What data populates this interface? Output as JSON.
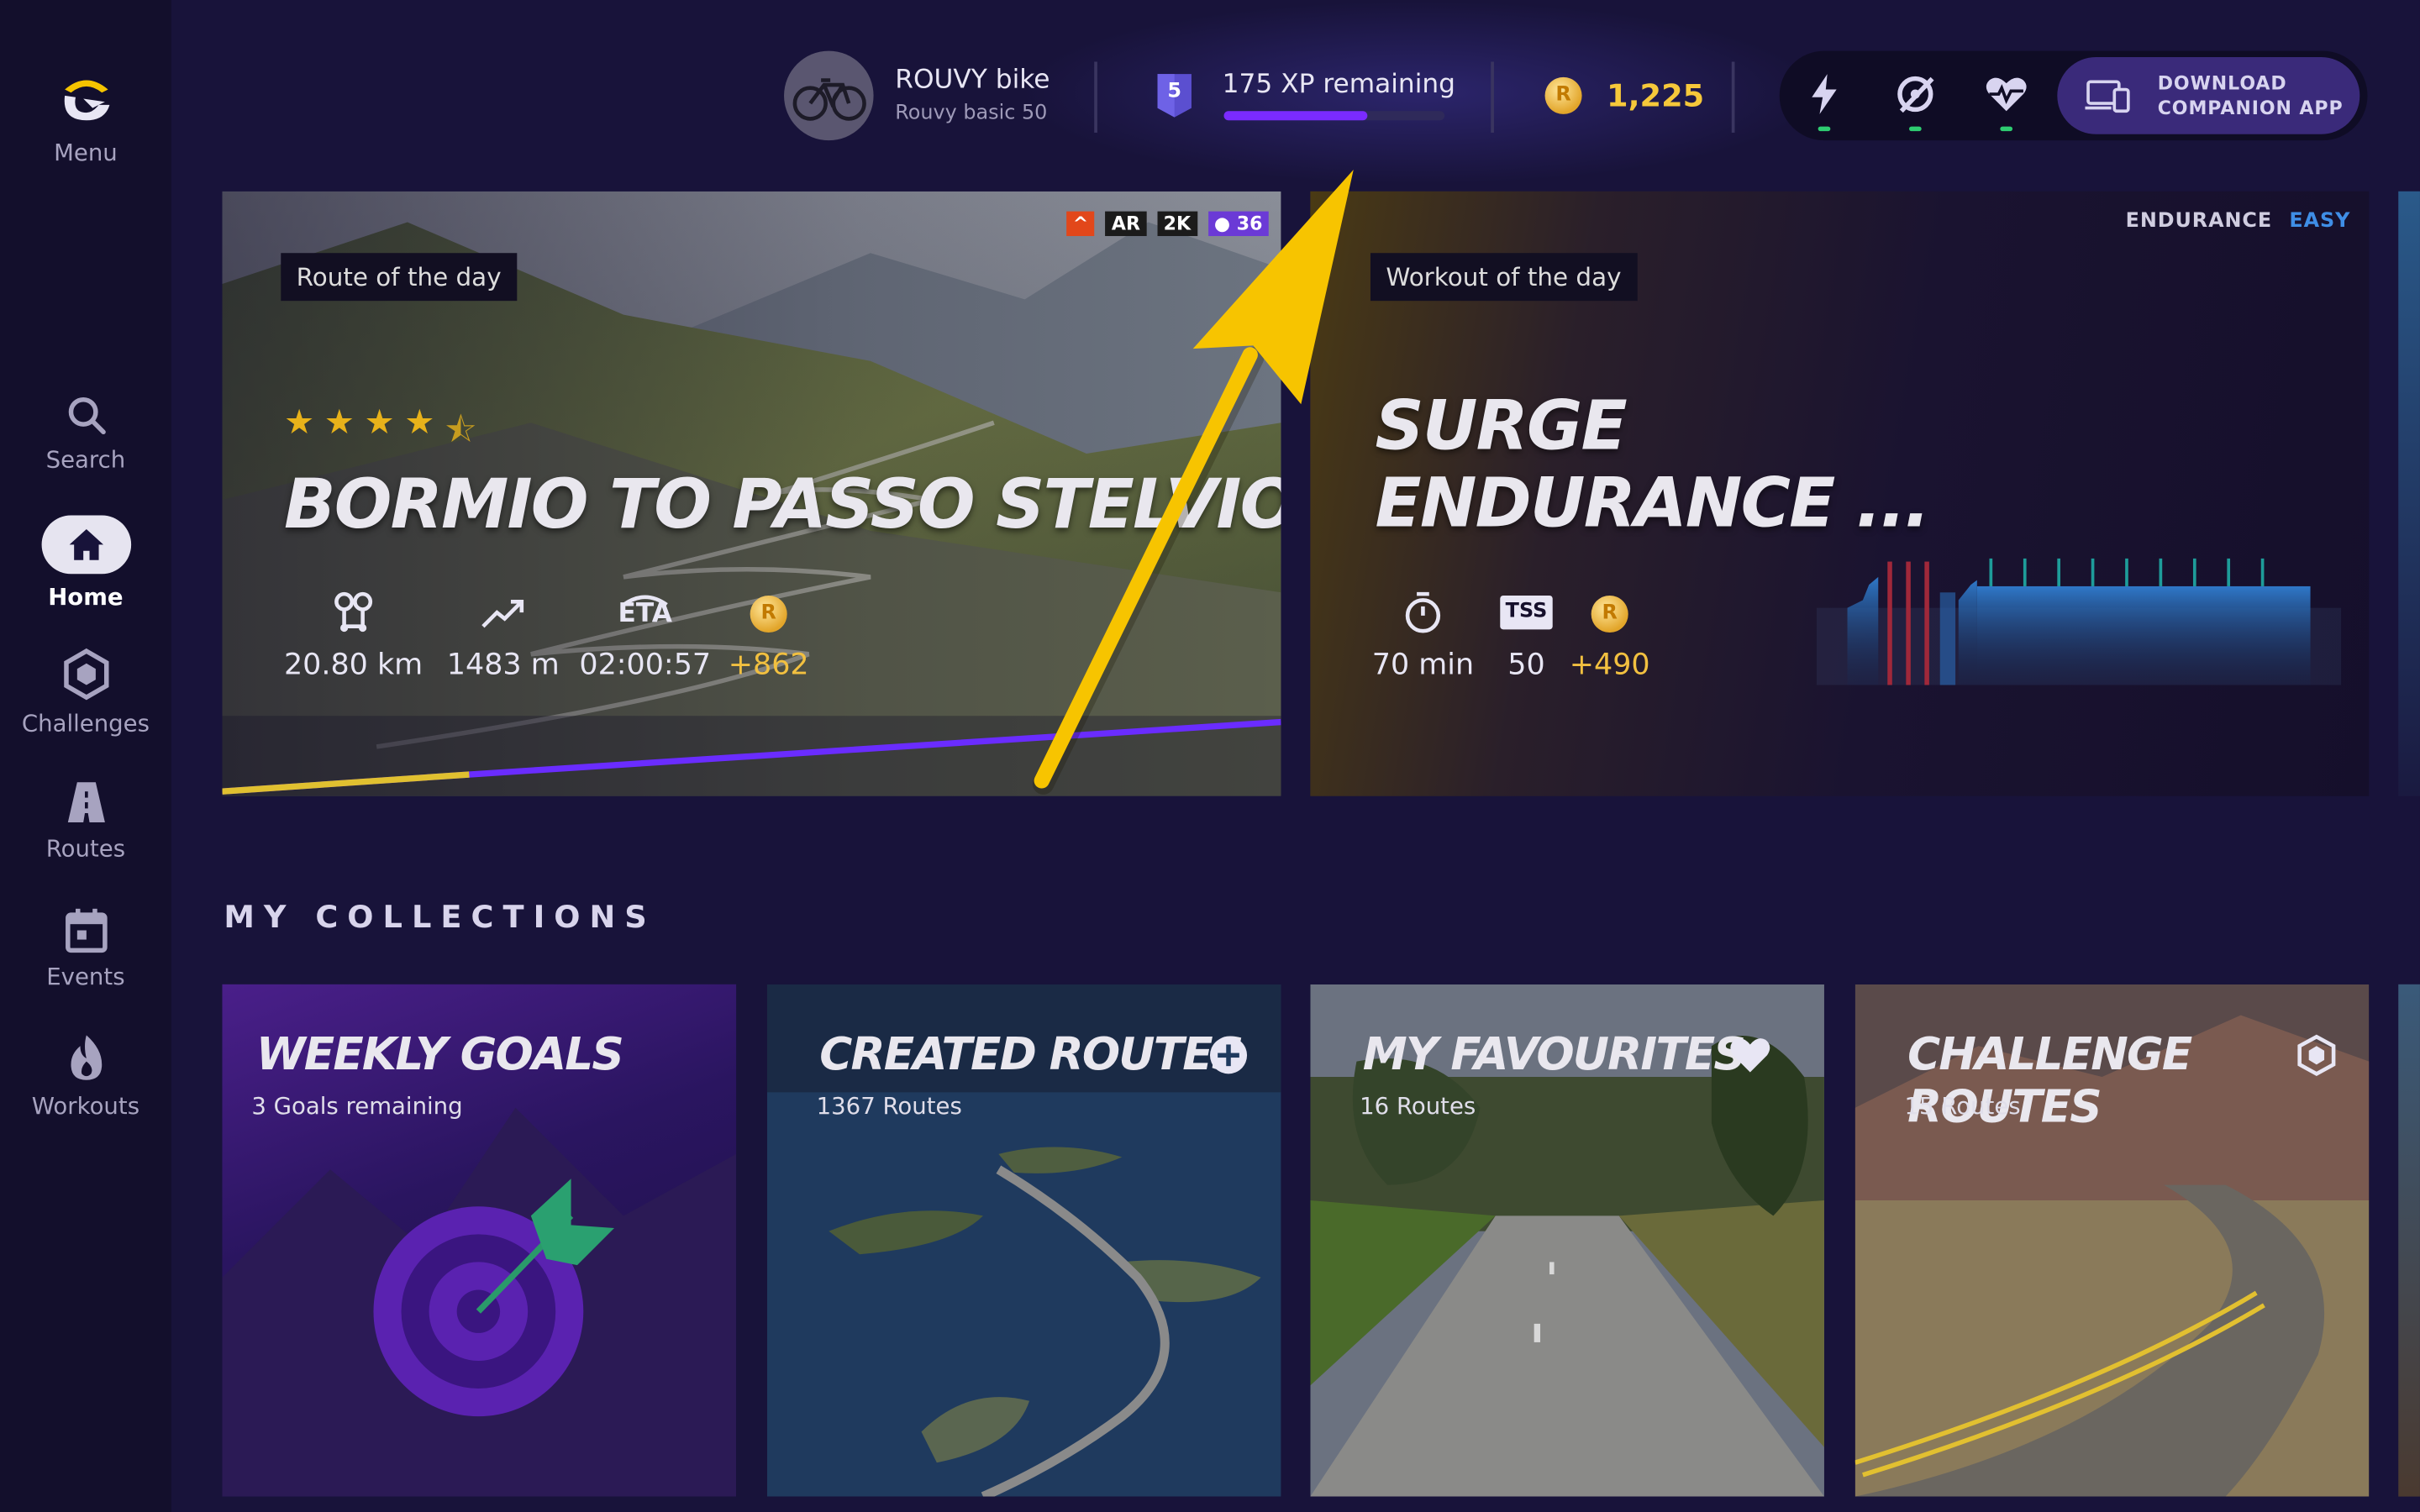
{
  "sidebar": {
    "menu_label": "Menu",
    "items": [
      {
        "label": "Search",
        "icon": "search-icon"
      },
      {
        "label": "Home",
        "icon": "home-icon"
      },
      {
        "label": "Challenges",
        "icon": "hexagon-icon"
      },
      {
        "label": "Routes",
        "icon": "road-icon"
      },
      {
        "label": "Events",
        "icon": "calendar-icon"
      },
      {
        "label": "Workouts",
        "icon": "flame-icon"
      }
    ]
  },
  "topbar": {
    "bike_name": "ROUVY bike",
    "bike_profile": "Rouvy basic 50",
    "level": "5",
    "xp_text": "175 XP remaining",
    "xp_progress": 0.65,
    "coins": "1,225",
    "download_line1": "DOWNLOAD",
    "download_line2": "COMPANION APP"
  },
  "route_of_day": {
    "tag": "Route of the day",
    "title": "BORMIO TO PASSO STELVIO |  ITALY",
    "rating": 4.5,
    "badges": [
      "AR",
      "2K",
      "36"
    ],
    "distance": "20.80 km",
    "elevation": "1483 m",
    "eta": "02:00:57",
    "eta_label": "ETA",
    "coins": "+862"
  },
  "workout_of_day": {
    "tag": "Workout of the day",
    "category": "ENDURANCE",
    "difficulty": "EASY",
    "title_line1": "SURGE",
    "title_line2": "ENDURANCE ...",
    "duration": "70 min",
    "tss_label": "TSS",
    "tss": "50",
    "coins": "+490"
  },
  "collections": {
    "title": "MY COLLECTIONS",
    "items": [
      {
        "title": "WEEKLY GOALS",
        "subtitle": "3 Goals remaining"
      },
      {
        "title": "CREATED ROUTES",
        "subtitle": "1367 Routes"
      },
      {
        "title": "MY FAVOURITES",
        "subtitle": "16 Routes"
      },
      {
        "title": "CHALLENGE ROUTES",
        "subtitle": "15 Routes"
      }
    ]
  },
  "colors": {
    "background": "#18133a",
    "accent_purple": "#7a2bff",
    "gold": "#f2c040",
    "annotation_arrow": "#f7c400"
  }
}
